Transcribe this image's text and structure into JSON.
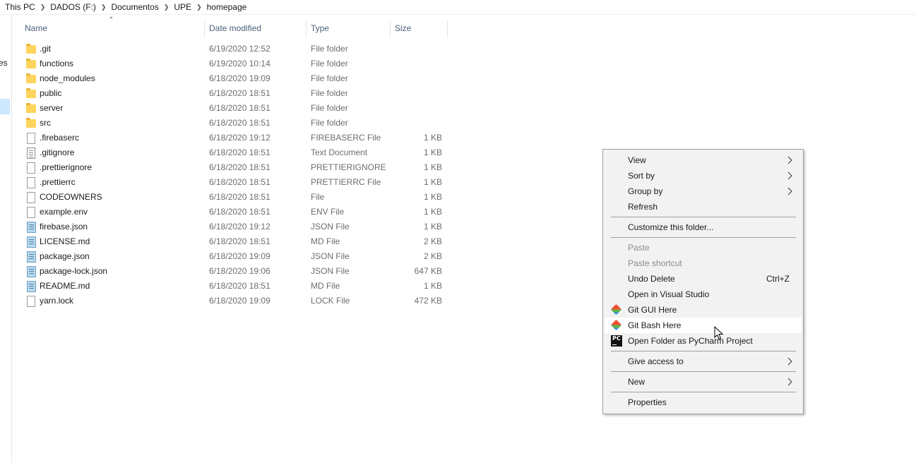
{
  "breadcrumb": [
    "This PC",
    "DADOS (F:)",
    "Documentos",
    "UPE",
    "homepage"
  ],
  "nav": {
    "partial_text": "es"
  },
  "columns": {
    "name": "Name",
    "date": "Date modified",
    "type": "Type",
    "size": "Size"
  },
  "files": [
    {
      "name": ".git",
      "date": "6/19/2020 12:52",
      "type": "File folder",
      "size": "",
      "icon": "folder-icon"
    },
    {
      "name": "functions",
      "date": "6/19/2020 10:14",
      "type": "File folder",
      "size": "",
      "icon": "folder-icon"
    },
    {
      "name": "node_modules",
      "date": "6/18/2020 19:09",
      "type": "File folder",
      "size": "",
      "icon": "folder-icon"
    },
    {
      "name": "public",
      "date": "6/18/2020 18:51",
      "type": "File folder",
      "size": "",
      "icon": "folder-icon"
    },
    {
      "name": "server",
      "date": "6/18/2020 18:51",
      "type": "File folder",
      "size": "",
      "icon": "folder-icon"
    },
    {
      "name": "src",
      "date": "6/18/2020 18:51",
      "type": "File folder",
      "size": "",
      "icon": "folder-icon"
    },
    {
      "name": ".firebaserc",
      "date": "6/18/2020 19:12",
      "type": "FIREBASERC File",
      "size": "1 KB",
      "icon": "file-icon"
    },
    {
      "name": ".gitignore",
      "date": "6/18/2020 18:51",
      "type": "Text Document",
      "size": "1 KB",
      "icon": "text-file-icon"
    },
    {
      "name": ".prettierignore",
      "date": "6/18/2020 18:51",
      "type": "PRETTIERIGNORE ...",
      "size": "1 KB",
      "icon": "file-icon"
    },
    {
      "name": ".prettierrc",
      "date": "6/18/2020 18:51",
      "type": "PRETTIERRC File",
      "size": "1 KB",
      "icon": "file-icon"
    },
    {
      "name": "CODEOWNERS",
      "date": "6/18/2020 18:51",
      "type": "File",
      "size": "1 KB",
      "icon": "file-icon"
    },
    {
      "name": "example.env",
      "date": "6/18/2020 18:51",
      "type": "ENV File",
      "size": "1 KB",
      "icon": "file-icon"
    },
    {
      "name": "firebase.json",
      "date": "6/18/2020 19:12",
      "type": "JSON File",
      "size": "1 KB",
      "icon": "code-file-icon"
    },
    {
      "name": "LICENSE.md",
      "date": "6/18/2020 18:51",
      "type": "MD File",
      "size": "2 KB",
      "icon": "code-file-icon"
    },
    {
      "name": "package.json",
      "date": "6/18/2020 19:09",
      "type": "JSON File",
      "size": "2 KB",
      "icon": "code-file-icon"
    },
    {
      "name": "package-lock.json",
      "date": "6/18/2020 19:06",
      "type": "JSON File",
      "size": "647 KB",
      "icon": "code-file-icon"
    },
    {
      "name": "README.md",
      "date": "6/18/2020 18:51",
      "type": "MD File",
      "size": "1 KB",
      "icon": "code-file-icon"
    },
    {
      "name": "yarn.lock",
      "date": "6/18/2020 19:09",
      "type": "LOCK File",
      "size": "472 KB",
      "icon": "file-icon"
    }
  ],
  "context_menu": {
    "items": [
      {
        "label": "View",
        "submenu": true
      },
      {
        "label": "Sort by",
        "submenu": true
      },
      {
        "label": "Group by",
        "submenu": true
      },
      {
        "label": "Refresh"
      },
      {
        "separator": true
      },
      {
        "label": "Customize this folder..."
      },
      {
        "separator": true
      },
      {
        "label": "Paste",
        "disabled": true
      },
      {
        "label": "Paste shortcut",
        "disabled": true
      },
      {
        "label": "Undo Delete",
        "shortcut": "Ctrl+Z"
      },
      {
        "label": "Open in Visual Studio"
      },
      {
        "label": "Git GUI Here",
        "icon": "git-icon"
      },
      {
        "label": "Git Bash Here",
        "icon": "git-icon",
        "hovered": true
      },
      {
        "label": "Open Folder as PyCharm Project",
        "icon": "pycharm-icon"
      },
      {
        "separator": true
      },
      {
        "label": "Give access to",
        "submenu": true
      },
      {
        "separator": true
      },
      {
        "label": "New",
        "submenu": true
      },
      {
        "separator": true
      },
      {
        "label": "Properties"
      }
    ]
  },
  "colors": {
    "selection": "#cce8ff",
    "header_text": "#4c607a",
    "menu_background": "#f2f2f2",
    "folder": "#ffd45c"
  }
}
